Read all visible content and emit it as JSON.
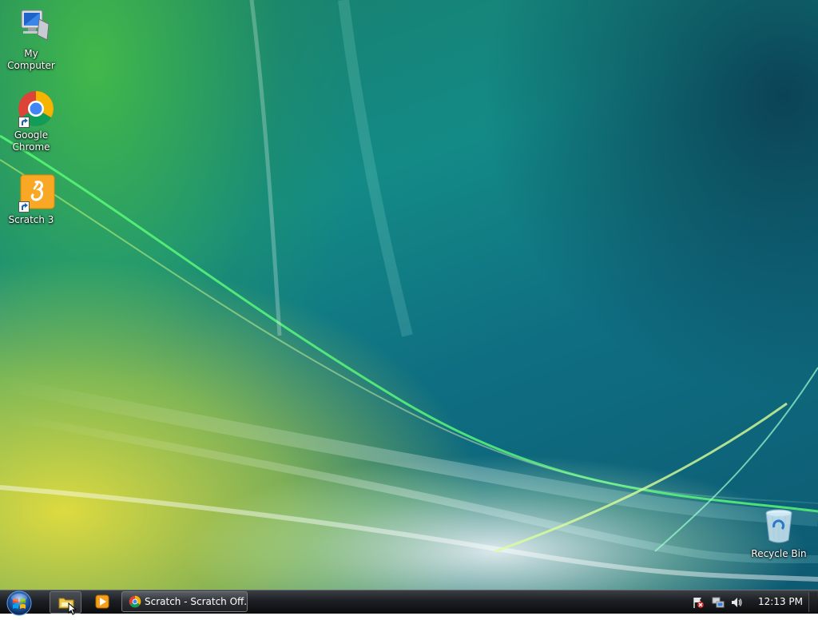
{
  "desktop": {
    "icons": [
      {
        "label": "My Computer",
        "icon": "my-computer-icon"
      },
      {
        "label": "Google Chrome",
        "icon": "chrome-icon"
      },
      {
        "label": "Scratch 3",
        "icon": "scratch-icon"
      },
      {
        "label": "Recycle Bin",
        "icon": "recycle-bin-icon"
      }
    ]
  },
  "taskbar": {
    "start_icon": "windows-start-orb",
    "quick_launch": [
      "file-explorer-icon",
      "media-player-icon"
    ],
    "tasks": [
      {
        "label": "Scratch - Scratch Off...",
        "icon": "chrome-icon"
      }
    ],
    "tray_icons": [
      "action-center-flag-icon",
      "network-icon",
      "volume-icon"
    ],
    "clock": "12:13 PM"
  },
  "colors": {
    "taskbar": "#1c1f23",
    "desktop_teal": "#138a86",
    "desktop_yellow": "#e8e03c",
    "desktop_green": "#46be46"
  }
}
